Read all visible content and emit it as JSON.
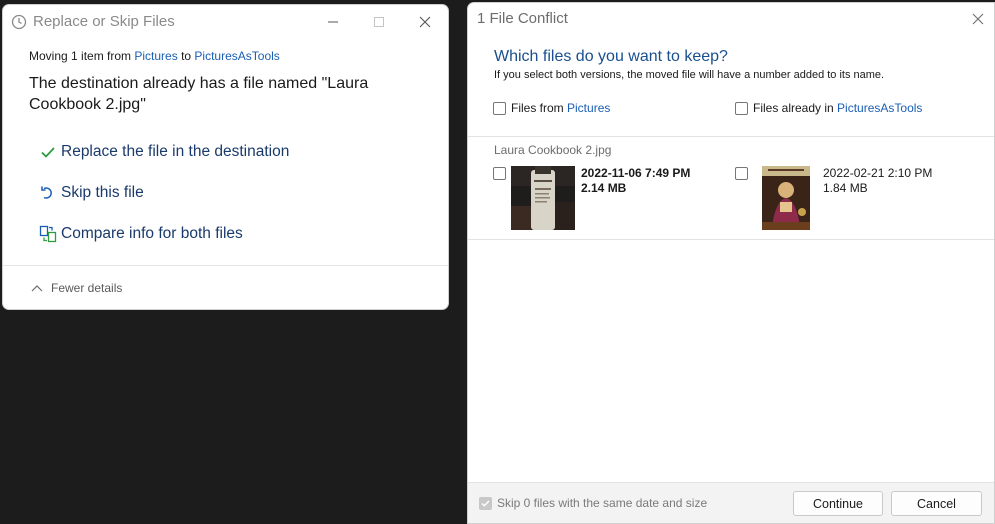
{
  "left_dialog": {
    "title": "Replace or Skip Files",
    "moving_prefix": "Moving 1 item from ",
    "from": "Pictures",
    "to_word": " to ",
    "to": "PicturesAsTools",
    "message": "The destination already has a file named \"Laura Cookbook 2.jpg\"",
    "options": [
      {
        "label": "Replace the file in the destination",
        "icon": "check-icon"
      },
      {
        "label": "Skip this file",
        "icon": "skip-arrow-icon"
      },
      {
        "label": "Compare info for both files",
        "icon": "compare-icon"
      }
    ],
    "details_toggle": "Fewer details"
  },
  "right_dialog": {
    "title": "1 File Conflict",
    "question": "Which files do you want to keep?",
    "note": "If you select both versions, the moved file will have a number added to its name.",
    "col_a_prefix": "Files from ",
    "col_a_link": "Pictures",
    "col_b_prefix": "Files already in ",
    "col_b_link": "PicturesAsTools",
    "file": {
      "name": "Laura Cookbook 2.jpg",
      "source": {
        "date": "2022-11-06 7:49 PM",
        "size": "2.14 MB",
        "thumbnail": "bottle-photo"
      },
      "destination": {
        "date": "2022-02-21 2:10 PM",
        "size": "1.84 MB",
        "thumbnail": "book-cover-photo"
      }
    },
    "skip_label": "Skip 0 files with the same date and size",
    "skip_checked": true,
    "continue_label": "Continue",
    "cancel_label": "Cancel"
  },
  "colors": {
    "accent_link": "#1a5fb4",
    "heading_blue": "#1a4f8f",
    "check_green": "#2e9b3e",
    "background": "#1c1c1c"
  }
}
